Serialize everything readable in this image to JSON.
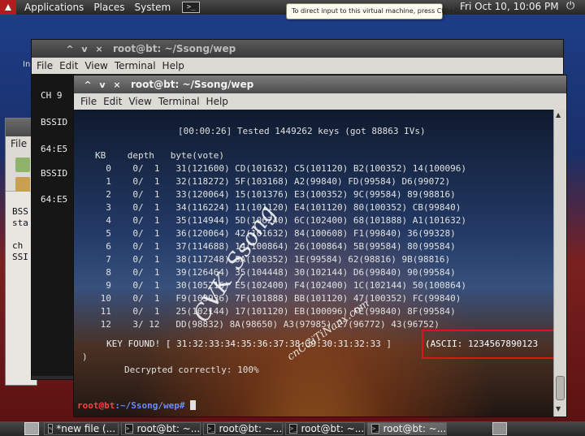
{
  "top_panel": {
    "menus": [
      "Applications",
      "Places",
      "System"
    ],
    "clock": "Fri Oct 10, 10:06 PM",
    "tooltip": "To direct input to this virtual machine, press Ctrl+G."
  },
  "desktop_icon_label": "In",
  "left_window": {
    "menu_label": "File",
    "lines": [
      "BSS",
      "sta",
      "",
      "ch",
      "SSI"
    ]
  },
  "back_terminal": {
    "title": "root@bt: ~/Ssong/wep",
    "menu": [
      "File",
      "Edit",
      "View",
      "Terminal",
      "Help"
    ],
    "lines": [
      "CH  9",
      "BSSID",
      "64:E5",
      "BSSID",
      "64:E5"
    ]
  },
  "front_terminal": {
    "title": "root@bt: ~/Ssong/wep",
    "menu": [
      "File",
      "Edit",
      "View",
      "Terminal",
      "Help"
    ],
    "status_line": "[00:00:26] Tested 1449262 keys (got 88863 IVs)",
    "table_header": "KB    depth   byte(vote)",
    "rows": [
      "  0    0/  1   31(121600) CD(101632) C5(101120) B2(100352) 14(100096)",
      "  1    0/  1   32(118272) 5F(103168) A2(99840) FD(99584) D6(99072)",
      "  2    0/  1   33(120064) 15(101376) E3(100352) 9C(99584) 89(98816)",
      "  3    0/  1   34(116224) 11(101120) E4(101120) 80(100352) CB(99840)",
      "  4    0/  1   35(114944) 5D(106240) 6C(102400) 68(101888) A1(101632)",
      "  5    0/  1   36(120064) 42(101632) 84(100608) F1(99840) 36(99328)",
      "  6    0/  1   37(114688) 14(100864) 26(100864) 5B(99584) 80(99584)",
      "  7    0/  1   38(117248) 5A(100352) 1E(99584) 62(98816) 9B(98816)",
      "  8    0/  1   39(126464) 35(104448) 30(102144) D6(99840) 90(99584)",
      "  9    0/  1   30(105216) E5(102400) F4(102400) 1C(102144) 50(100864)",
      " 10    0/  1   F9(103936) 7F(101888) BB(101120) 47(100352) FC(99840)",
      " 11    0/  1   25(102144) 17(101120) EB(100096) FE(99840) 8F(99584)",
      " 12    3/ 12   DD(98832) 8A(98650) A3(97985) 27(96772) 43(96752)"
    ],
    "key_found": "KEY FOUND! [ 31:32:33:34:35:36:37:38:39:30:31:32:33 ]",
    "ascii": "(ASCII: 1234567890123",
    "ascii_close": ")",
    "decrypted": "Decrypted correctly: 100%",
    "prompt_user": "root@bt",
    "prompt_path": ":~/Ssong/wep#"
  },
  "watermarks": [
    "CVK_Ssong",
    "cnCGiTiNanx.com"
  ],
  "taskbar": {
    "tasks": [
      "*new file (...",
      "root@bt: ~...",
      "root@bt: ~...",
      "root@bt: ~...",
      "root@bt: ~..."
    ]
  },
  "colors": {
    "highlight_box": "#e01414",
    "prompt_red": "#ff4040",
    "prompt_blue": "#6b8cff"
  }
}
